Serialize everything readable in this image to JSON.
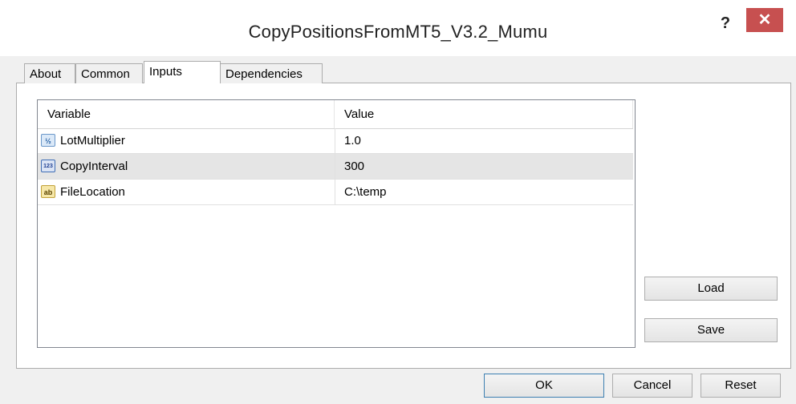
{
  "window": {
    "title": "CopyPositionsFromMT5_V3.2_Mumu",
    "help_label": "?",
    "close_label": "✕",
    "close_color": "#c75050"
  },
  "tabs": [
    {
      "label": "About"
    },
    {
      "label": "Common"
    },
    {
      "label": "Inputs",
      "active": true
    },
    {
      "label": "Dependencies"
    }
  ],
  "grid": {
    "columns": [
      "Variable",
      "Value"
    ],
    "rows": [
      {
        "icon": "fraction-type-icon",
        "icon_text": "½",
        "variable": "LotMultiplier",
        "value": "1.0"
      },
      {
        "icon": "integer-type-icon",
        "icon_text": "123",
        "variable": "CopyInterval",
        "value": "300",
        "selected": true
      },
      {
        "icon": "string-type-icon",
        "icon_text": "ab",
        "variable": "FileLocation",
        "value": "C:\\temp"
      }
    ]
  },
  "buttons": {
    "load": "Load",
    "save": "Save",
    "ok": "OK",
    "cancel": "Cancel",
    "reset": "Reset"
  }
}
